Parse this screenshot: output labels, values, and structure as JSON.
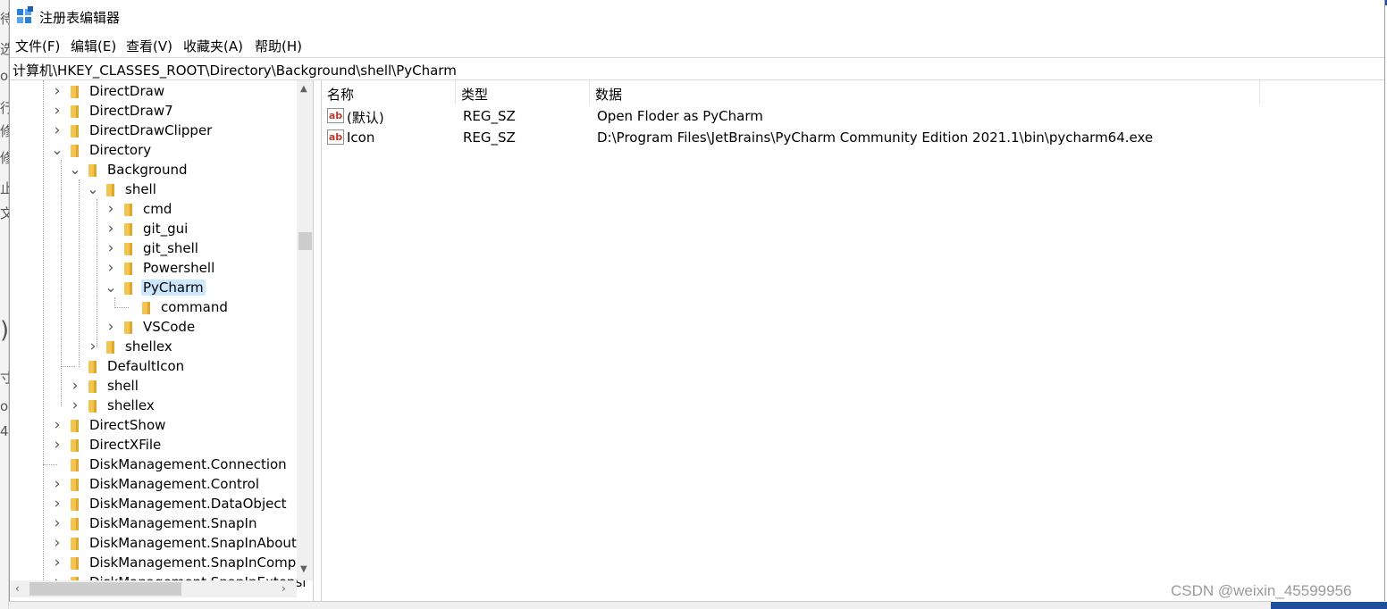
{
  "window": {
    "title": "注册表编辑器"
  },
  "menu": [
    "文件(F)",
    "编辑(E)",
    "查看(V)",
    "收藏夹(A)",
    "帮助(H)"
  ],
  "address": "计算机\\HKEY_CLASSES_ROOT\\Directory\\Background\\shell\\PyCharm",
  "tree": [
    {
      "label": "DirectDraw",
      "expander": "collapsed"
    },
    {
      "label": "DirectDraw7",
      "expander": "collapsed"
    },
    {
      "label": "DirectDrawClipper",
      "expander": "collapsed"
    },
    {
      "label": "Directory",
      "expander": "expanded"
    },
    {
      "label": "Background",
      "expander": "expanded"
    },
    {
      "label": "shell",
      "expander": "expanded"
    },
    {
      "label": "cmd",
      "expander": "collapsed"
    },
    {
      "label": "git_gui",
      "expander": "collapsed"
    },
    {
      "label": "git_shell",
      "expander": "collapsed"
    },
    {
      "label": "Powershell",
      "expander": "collapsed"
    },
    {
      "label": "PyCharm",
      "expander": "expanded",
      "selected": true
    },
    {
      "label": "command",
      "expander": "none"
    },
    {
      "label": "VSCode",
      "expander": "collapsed"
    },
    {
      "label": "shellex",
      "expander": "collapsed"
    },
    {
      "label": "DefaultIcon",
      "expander": "none"
    },
    {
      "label": "shell",
      "expander": "collapsed"
    },
    {
      "label": "shellex",
      "expander": "collapsed"
    },
    {
      "label": "DirectShow",
      "expander": "collapsed"
    },
    {
      "label": "DirectXFile",
      "expander": "collapsed"
    },
    {
      "label": "DiskManagement.Connection",
      "expander": "none"
    },
    {
      "label": "DiskManagement.Control",
      "expander": "collapsed"
    },
    {
      "label": "DiskManagement.DataObject",
      "expander": "collapsed"
    },
    {
      "label": "DiskManagement.SnapIn",
      "expander": "collapsed"
    },
    {
      "label": "DiskManagement.SnapInAbout",
      "expander": "collapsed"
    },
    {
      "label": "DiskManagement.SnapInCompo",
      "expander": "collapsed"
    },
    {
      "label": "DiskManagement.SnapInExtensi",
      "expander": "collapsed"
    }
  ],
  "list": {
    "columns": [
      "名称",
      "类型",
      "数据"
    ],
    "rows": [
      {
        "icon": "ab",
        "name": "(默认)",
        "type": "REG_SZ",
        "data": "Open Floder as PyCharm"
      },
      {
        "icon": "ab",
        "name": "Icon",
        "type": "REG_SZ",
        "data": "D:\\Program Files\\JetBrains\\PyCharm Community Edition 2021.1\\bin\\pycharm64.exe"
      }
    ]
  },
  "watermark": "CSDN @weixin_45599956",
  "icons": {
    "app": "registry-editor-icon",
    "folder": "folder-icon",
    "string_value": "string-value-icon",
    "expand": "chevron-right-icon",
    "collapse": "chevron-down-icon"
  },
  "colors": {
    "selection": "#cce8ff",
    "folder": "#f1c550",
    "scrollbar": "#f0f0f0"
  }
}
